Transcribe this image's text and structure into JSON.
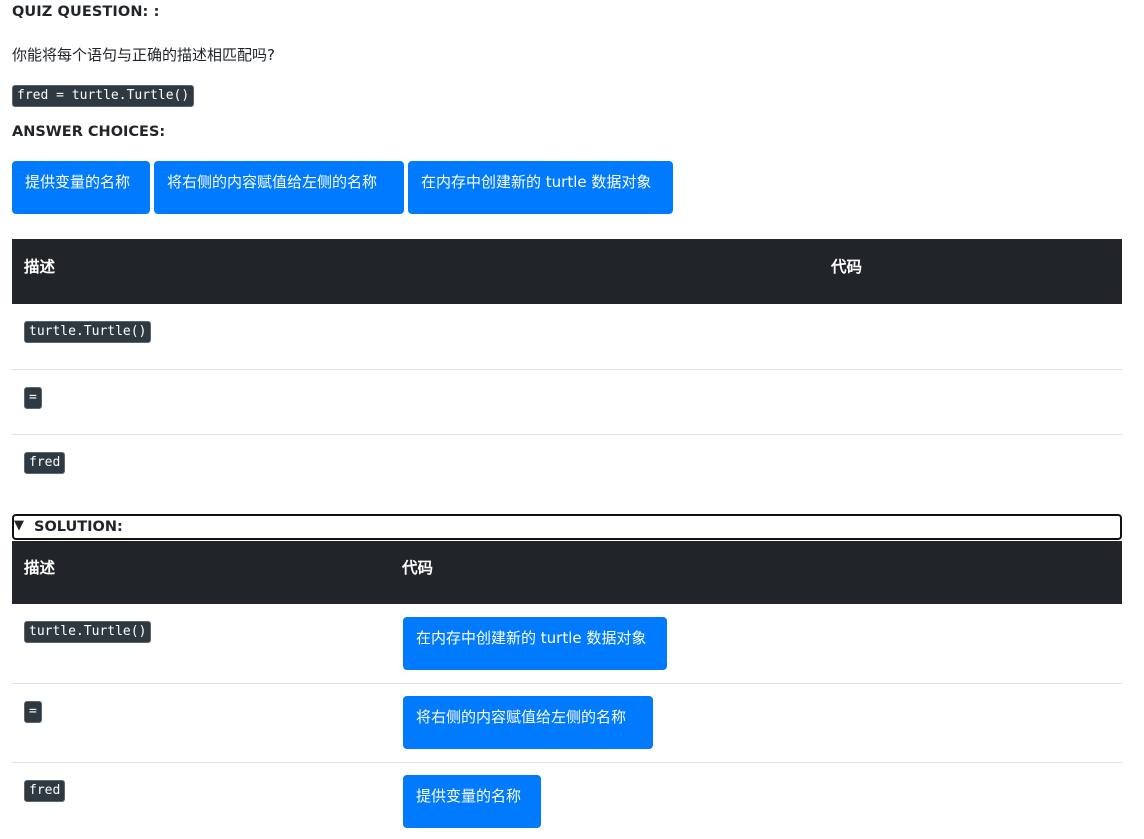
{
  "quiz": {
    "question_label": "QUIZ QUESTION: :",
    "question_text": "你能将每个语句与正确的描述相匹配吗?",
    "code": "fred = turtle.Turtle()"
  },
  "choices": {
    "label": "ANSWER CHOICES:",
    "items": [
      "提供变量的名称",
      "将右侧的内容赋值给左侧的名称",
      "在内存中创建新的 turtle 数据对象"
    ]
  },
  "question_table": {
    "headers": [
      "描述",
      "代码"
    ],
    "rows": [
      {
        "code": "turtle.Turtle()"
      },
      {
        "code": "="
      },
      {
        "code": "fred"
      }
    ]
  },
  "solution": {
    "toggle_icon": "▼",
    "label": "SOLUTION:",
    "headers": [
      "描述",
      "代码"
    ],
    "rows": [
      {
        "code": "turtle.Turtle()",
        "answer": "在内存中创建新的 turtle 数据对象"
      },
      {
        "code": "=",
        "answer": "将右侧的内容赋值给左侧的名称"
      },
      {
        "code": "fred",
        "answer": "提供变量的名称"
      }
    ]
  },
  "colors": {
    "primary": "#007bff",
    "table_header": "#212529",
    "code_bg": "#2f3942"
  }
}
